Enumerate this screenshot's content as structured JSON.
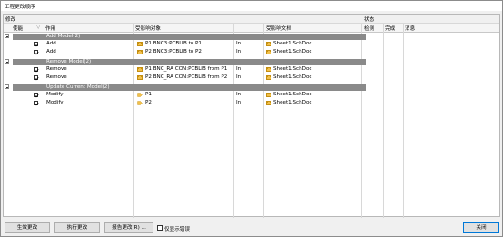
{
  "window": {
    "title": "工程更改顺序"
  },
  "headers": {
    "modify_section": "修改",
    "status_section": "状态",
    "enable": "使能",
    "action": "作用",
    "affected_object": "受影响对象",
    "affected_document": "受影响文档",
    "check": "检测",
    "done": "完成",
    "message": "消息",
    "sort_indicator": "▽"
  },
  "groups": [
    {
      "label": "Add Model(2)",
      "rows": [
        {
          "action": "Add",
          "object": "P1 BNC3:PCBLIB to P1",
          "in": "In",
          "document": "Sheet1.SchDoc"
        },
        {
          "action": "Add",
          "object": "P2 BNC3:PCBLIB to P2",
          "in": "In",
          "document": "Sheet1.SchDoc"
        }
      ]
    },
    {
      "label": "Remove Model(2)",
      "rows": [
        {
          "action": "Remove",
          "object": "P1 BNC_RA CON:PCBLIB from P1",
          "in": "In",
          "document": "Sheet1.SchDoc"
        },
        {
          "action": "Remove",
          "object": "P2 BNC_RA CON:PCBLIB from P2",
          "in": "In",
          "document": "Sheet1.SchDoc"
        }
      ]
    },
    {
      "label": "Update Current Model(2)",
      "rows": [
        {
          "action": "Modify",
          "object": "P1",
          "in": "In",
          "document": "Sheet1.SchDoc"
        },
        {
          "action": "Modify",
          "object": "P2",
          "in": "In",
          "document": "Sheet1.SchDoc"
        }
      ]
    }
  ],
  "buttons": {
    "validate": "生效更改",
    "execute": "执行更改",
    "report": "报告更改(R) ...",
    "only_errors": "仅显示错误",
    "close": "关闭"
  },
  "colors": {
    "group_bar": "#8a8a8a",
    "folder": "#e08a2a",
    "doc": "#f2c04a",
    "accent": "#0078d7"
  }
}
